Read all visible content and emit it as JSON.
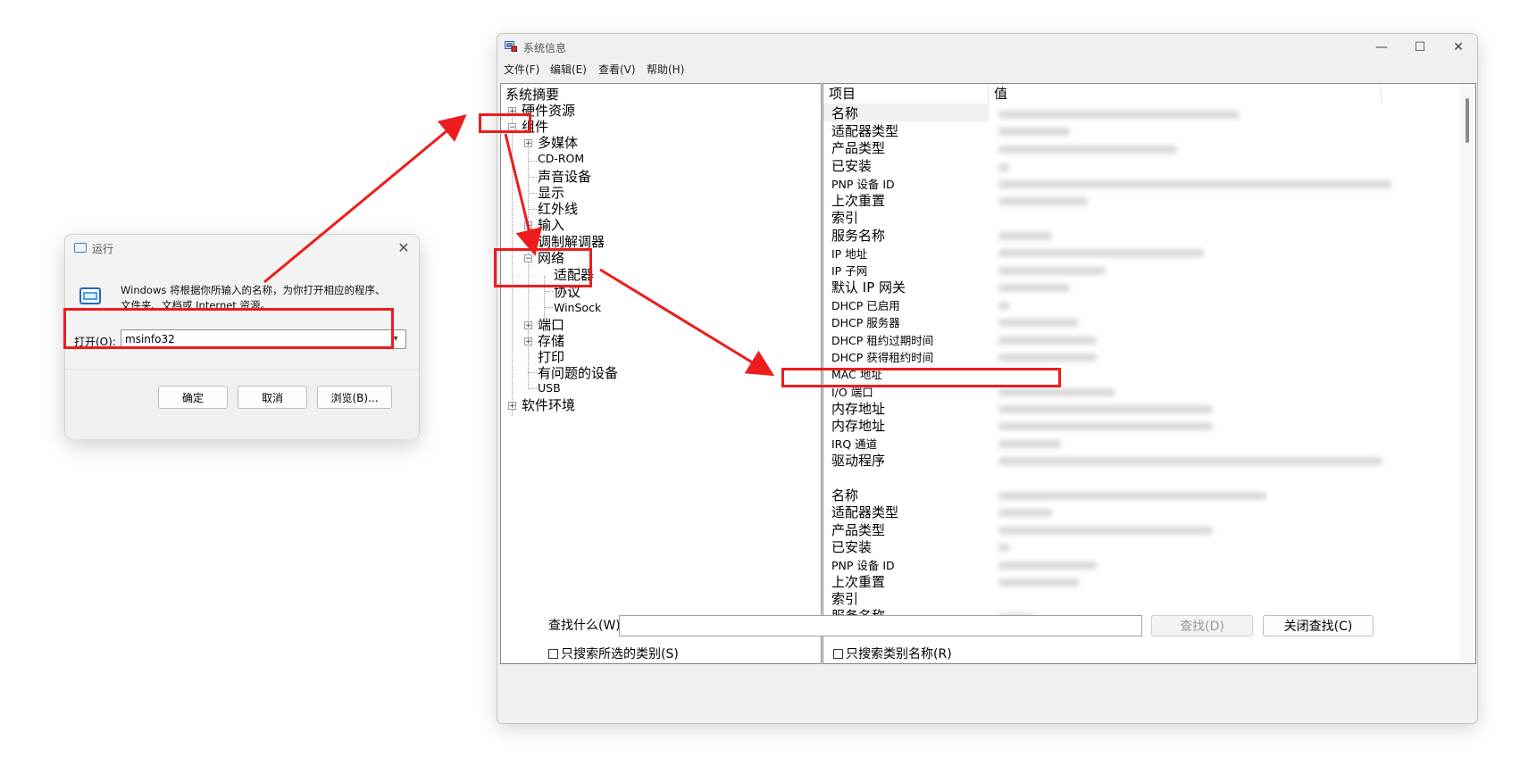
{
  "run_dialog": {
    "title": "运行",
    "description_line1": "Windows 将根据你所输入的名称，为你打开相应的程序、",
    "description_line2": "文件夹、文档或 Internet 资源。",
    "open_label": "打开(O):",
    "open_value": "msinfo32",
    "ok": "确定",
    "cancel": "取消",
    "browse": "浏览(B)..."
  },
  "msinfo": {
    "title": "系统信息",
    "menus": [
      "文件(F)",
      "编辑(E)",
      "查看(V)",
      "帮助(H)"
    ],
    "tree": {
      "root": "系统摘要",
      "hardware": "硬件资源",
      "components": "组件",
      "multimedia": "多媒体",
      "cdrom": "CD-ROM",
      "sound": "声音设备",
      "display": "显示",
      "infrared": "红外线",
      "input": "输入",
      "modem": "调制解调器",
      "network": "网络",
      "adapter": "适配器",
      "protocol": "协议",
      "winsock": "WinSock",
      "ports": "端口",
      "storage": "存储",
      "printing": "打印",
      "problem_devices": "有问题的设备",
      "usb": "USB",
      "software": "软件环境"
    },
    "columns": {
      "item": "项目",
      "value": "值"
    },
    "rows_a": [
      "名称",
      "适配器类型",
      "产品类型",
      "已安装",
      "PNP 设备 ID",
      "上次重置",
      "索引",
      "服务名称",
      "IP 地址",
      "IP 子网",
      "默认 IP 网关",
      "DHCP 已启用",
      "DHCP 服务器",
      "DHCP 租约过期时间",
      "DHCP 获得租约时间",
      "MAC 地址",
      "I/O 端口",
      "内存地址",
      "内存地址",
      "IRQ 通道",
      "驱动程序"
    ],
    "rows_b": [
      "名称",
      "适配器类型",
      "产品类型",
      "已安装",
      "PNP 设备 ID",
      "上次重置",
      "索引",
      "服务名称"
    ],
    "find_label": "查找什么(W):",
    "find_button": "查找(D)",
    "close_find_button": "关闭查找(C)",
    "only_selected_category": "只搜索所选的类别(S)",
    "only_category_names": "只搜索类别名称(R)"
  }
}
